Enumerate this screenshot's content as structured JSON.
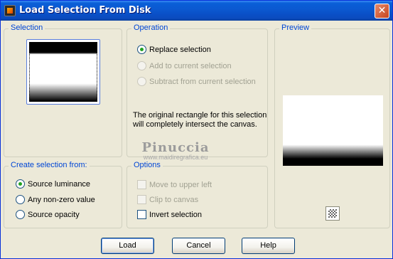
{
  "window": {
    "title": "Load Selection From Disk",
    "close_glyph": "✕"
  },
  "selection": {
    "legend": "Selection"
  },
  "operation": {
    "legend": "Operation",
    "options": [
      {
        "label": "Replace selection",
        "checked": true,
        "enabled": true
      },
      {
        "label": "Add to current selection",
        "checked": false,
        "enabled": false
      },
      {
        "label": "Subtract from current selection",
        "checked": false,
        "enabled": false
      }
    ],
    "info_line1": "The original rectangle for this selection",
    "info_line2": "will completely intersect the canvas."
  },
  "preview": {
    "legend": "Preview",
    "zoom_icon": "checker-preview-icon"
  },
  "create_from": {
    "legend": "Create selection from:",
    "options": [
      {
        "label": "Source luminance",
        "checked": true
      },
      {
        "label": "Any non-zero value",
        "checked": false
      },
      {
        "label": "Source opacity",
        "checked": false
      }
    ]
  },
  "options": {
    "legend": "Options",
    "items": [
      {
        "label": "Move to upper left",
        "checked": false,
        "enabled": false
      },
      {
        "label": "Clip to canvas",
        "checked": false,
        "enabled": false
      },
      {
        "label": "Invert selection",
        "checked": false,
        "enabled": true
      }
    ]
  },
  "watermark": {
    "line1": "Pinuccia",
    "line2": "www.maidiregrafica.eu"
  },
  "buttons": {
    "load": "Load",
    "cancel": "Cancel",
    "help": "Help"
  },
  "colors": {
    "accent": "#0046d5",
    "titlebar": "#0a5fd8",
    "radio_dot": "#21a121"
  }
}
